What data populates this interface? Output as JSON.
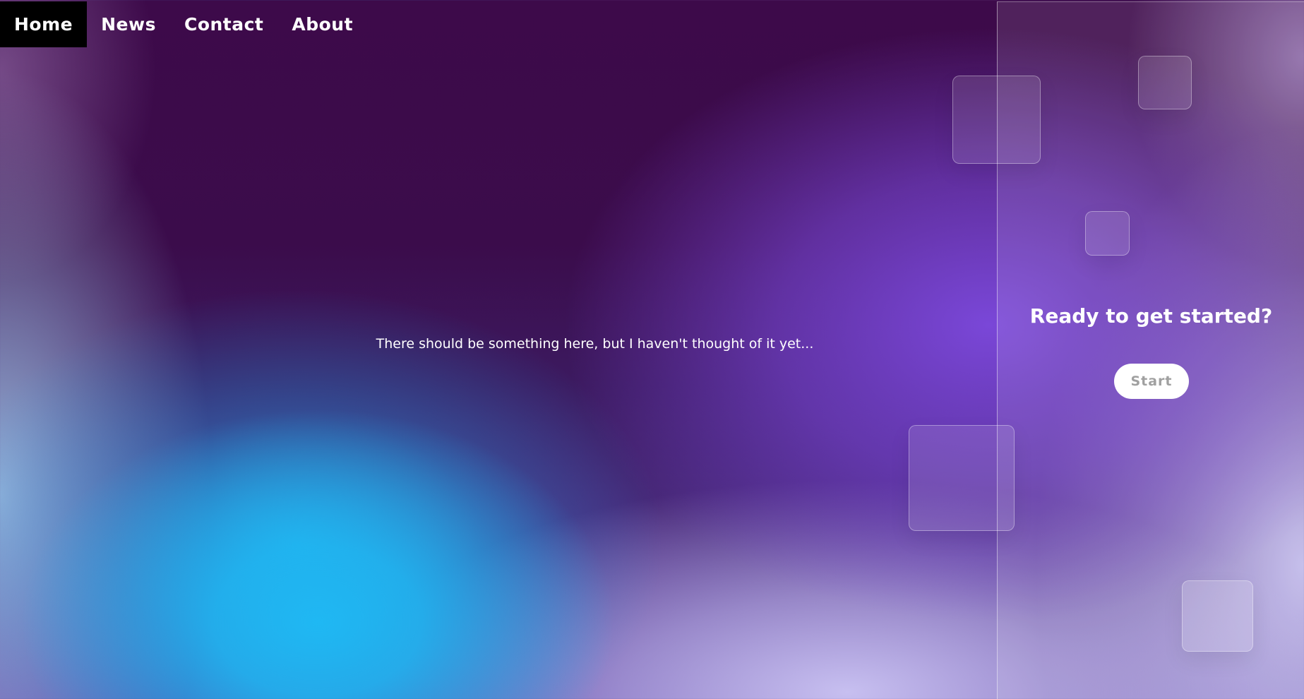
{
  "nav": {
    "items": [
      {
        "label": "Home",
        "active": true
      },
      {
        "label": "News",
        "active": false
      },
      {
        "label": "Contact",
        "active": false
      },
      {
        "label": "About",
        "active": false
      }
    ]
  },
  "hero": {
    "text": "There should be something here, but I haven't thought of it yet..."
  },
  "panel": {
    "title": "Ready to get started?",
    "button_label": "Start"
  },
  "colors": {
    "accent_purple": "#7a47d8",
    "accent_blue": "#1fb8f3",
    "deep_plum": "#3d0a4a",
    "active_nav": "#000000"
  }
}
